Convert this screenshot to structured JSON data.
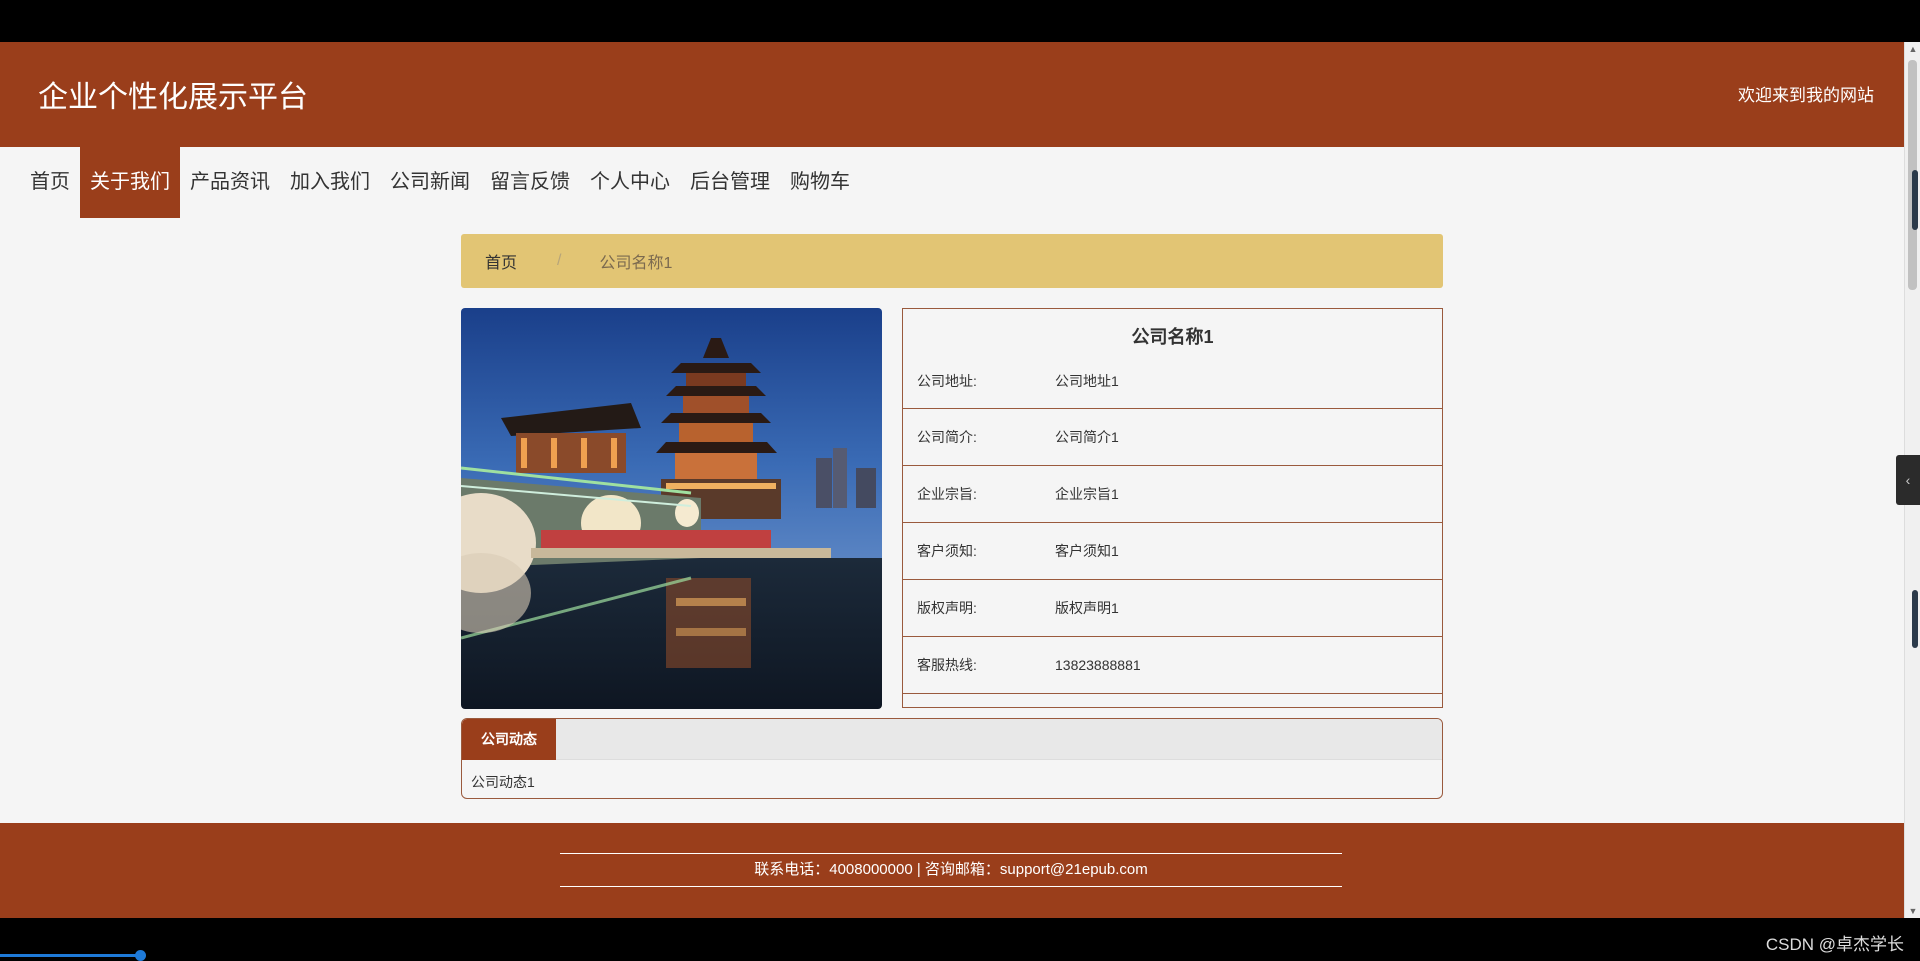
{
  "header": {
    "site_title": "企业个性化展示平台",
    "welcome": "欢迎来到我的网站"
  },
  "nav": [
    {
      "label": "首页",
      "active": false
    },
    {
      "label": "关于我们",
      "active": true
    },
    {
      "label": "产品资讯",
      "active": false
    },
    {
      "label": "加入我们",
      "active": false
    },
    {
      "label": "公司新闻",
      "active": false
    },
    {
      "label": "留言反馈",
      "active": false
    },
    {
      "label": "个人中心",
      "active": false
    },
    {
      "label": "后台管理",
      "active": false
    },
    {
      "label": "购物车",
      "active": false
    }
  ],
  "breadcrumb": {
    "home": "首页",
    "separator": "/",
    "current": "公司名称1"
  },
  "company": {
    "name": "公司名称1",
    "rows": [
      {
        "label": "公司地址:",
        "value": "公司地址1"
      },
      {
        "label": "公司简介:",
        "value": "公司简介1"
      },
      {
        "label": "企业宗旨:",
        "value": "企业宗旨1"
      },
      {
        "label": "客户须知:",
        "value": "客户须知1"
      },
      {
        "label": "版权声明:",
        "value": "版权声明1"
      },
      {
        "label": "客服热线:",
        "value": "13823888881"
      }
    ]
  },
  "tabs": {
    "active_tab": "公司动态",
    "content": "公司动态1"
  },
  "footer": {
    "text": "联系电话：4008000000 | 咨询邮箱：support@21epub.com"
  },
  "overlay": {
    "watermark": "CSDN @卓杰学长",
    "side_tab_icon": "chevron-left-icon"
  },
  "colors": {
    "brand": "#9a3e1b",
    "breadcrumb_bg": "#e2c574",
    "player_progress": "#1e7ad8"
  }
}
